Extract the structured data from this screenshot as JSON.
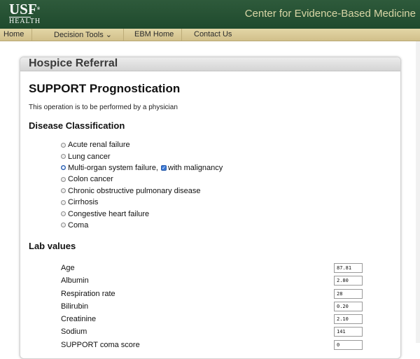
{
  "header": {
    "logo_text": "USF",
    "logo_subtext": "HEALTH",
    "site_title": "Center for Evidence-Based Medicine"
  },
  "nav": {
    "items": [
      {
        "label": "Home"
      },
      {
        "label": "Decision Tools ⌄"
      },
      {
        "label": "EBM Home"
      },
      {
        "label": "Contact Us"
      }
    ]
  },
  "panel": {
    "title": "Hospice Referral",
    "heading": "SUPPORT Prognostication",
    "note": "This operation is to be performed by a physician",
    "disease_heading": "Disease Classification",
    "diseases": [
      {
        "label": "Acute renal failure",
        "selected": false
      },
      {
        "label": "Lung cancer",
        "selected": false
      },
      {
        "label": "Multi-organ system failure,",
        "selected": true,
        "checkbox_label": "with malignancy",
        "checked": true
      },
      {
        "label": "Colon cancer",
        "selected": false
      },
      {
        "label": "Chronic obstructive pulmonary disease",
        "selected": false
      },
      {
        "label": "Cirrhosis",
        "selected": false
      },
      {
        "label": "Congestive heart failure",
        "selected": false
      },
      {
        "label": "Coma",
        "selected": false
      }
    ],
    "lab_heading": "Lab values",
    "labs": [
      {
        "label": "Age",
        "value": "87.81"
      },
      {
        "label": "Albumin",
        "value": "2.80"
      },
      {
        "label": "Respiration rate",
        "value": "28"
      },
      {
        "label": "Bilirubin",
        "value": "0.20"
      },
      {
        "label": "Creatinine",
        "value": "2.10"
      },
      {
        "label": "Sodium",
        "value": "141"
      },
      {
        "label": "SUPPORT coma score",
        "value": "0"
      }
    ]
  },
  "colors": {
    "header_green": "#1f4a2d",
    "title_tan": "#d9d6a6",
    "nav_tan": "#d9c894",
    "accent_blue": "#3a78d6"
  }
}
